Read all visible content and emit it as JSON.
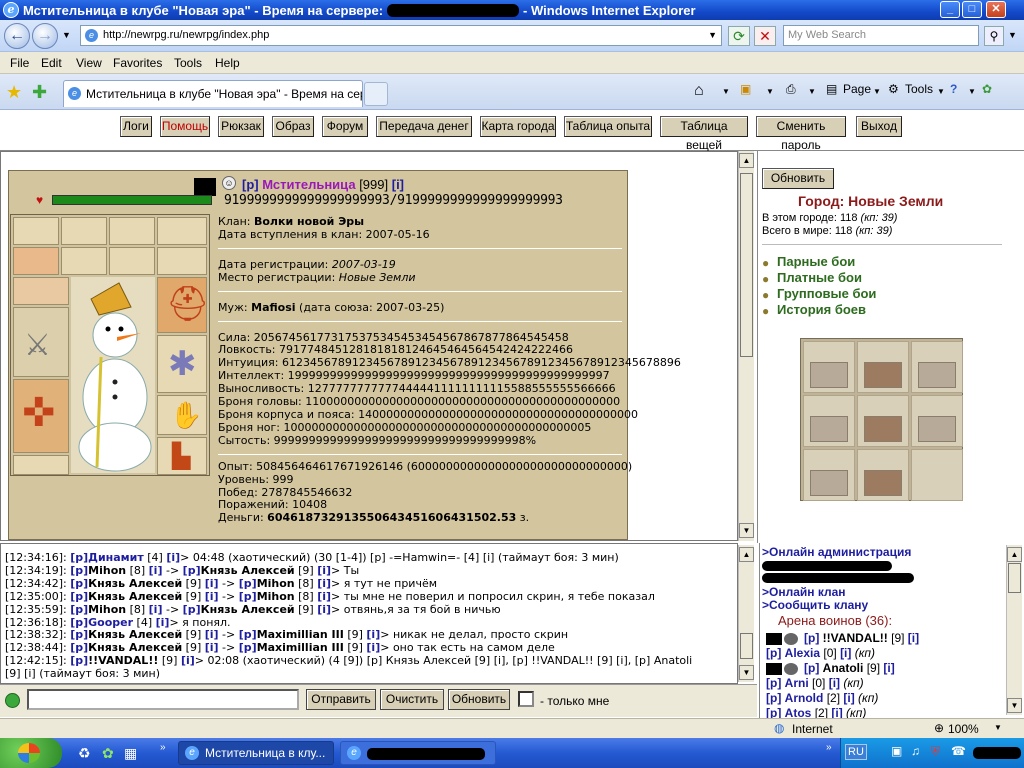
{
  "window": {
    "title_prefix": "Мстительница в клубе \"Новая эра\" - Время на сервере:",
    "title_suffix": "- Windows Internet Explorer",
    "minimize": "_",
    "maximize": "□",
    "close": "✕"
  },
  "address": {
    "url": "http://newrpg.ru/newrpg/index.php",
    "search_placeholder": "My Web Search"
  },
  "menu": [
    "File",
    "Edit",
    "View",
    "Favorites",
    "Tools",
    "Help"
  ],
  "tab": {
    "label": "Мстительница в клубе \"Новая эра\" - Время на сервер..."
  },
  "commandbar": {
    "page": "Page",
    "tools": "Tools"
  },
  "game_buttons": [
    "Логи",
    "Помощь",
    "Рюкзак",
    "Образ",
    "Форум",
    "Передача денег",
    "Карта города",
    "Таблица опыта",
    "Таблица вещей",
    "Сменить пароль",
    "Выход"
  ],
  "character": {
    "tag": "[p]",
    "name": "Мстительница",
    "level": "[999]",
    "info": "[i]",
    "hp": "9199999999999999999993/9199999999999999999993"
  },
  "profile": {
    "clan_label": "Клан:",
    "clan": "Волки новой Эры",
    "clan_join": "Дата вступления в клан: 2007-05-16",
    "reg_date_label": "Дата регистрации:",
    "reg_date": "2007-03-19",
    "reg_place_label": "Место регистрации:",
    "reg_place": "Новые Земли",
    "husband_label": "Муж:",
    "husband": "Mafiosi",
    "union": "(дата союза: 2007-03-25)",
    "stats": [
      "Сила: 205674561773175375345453454567867877864545458",
      "Ловкость: 791774845128181818124645464564542424222466",
      "Интуиция: 612345678912345678912345678912345678912345678912345678896",
      "Интеллект: 1999999999999999999999999999999999999999999997",
      "Выносливость: 12777777777774444411111111115588555555566666",
      "Броня головы: 110000000000000000000000000000000000000000000",
      "Броня корпуса и пояса: 1400000000000000000000000000000000000000",
      "Броня ног: 10000000000000000000000000000000000000000005",
      "Сытость: 999999999999999999999999999999999998%"
    ],
    "exp": "Опыт: 508456464617671926146 (6000000000000000000000000000000)",
    "level": "Уровень: 999",
    "wins": "Побед: 2787845546632",
    "losses": "Поражений: 10408",
    "money_label": "Деньги:",
    "money": "604618732913550643451606431502.53",
    "money_unit": "з."
  },
  "city": {
    "refresh": "Обновить",
    "title": "Город: Новые Земли",
    "in_city": "В этом городе: 118",
    "in_city_kp": "(кп: 39)",
    "in_world": "Всего в мире: 118",
    "in_world_kp": "(кп: 39)",
    "links": [
      "Парные бои",
      "Платные бои",
      "Групповые бои",
      "История боев"
    ]
  },
  "chat": [
    {
      "t": "[12:34:16]:",
      "text": [
        [
          "b",
          "[p]"
        ],
        [
          "nb",
          "Динамит"
        ],
        [
          "x",
          " [4] "
        ],
        [
          "b",
          "[i]"
        ],
        [
          "x",
          "> 04:48 (хаотический) (30 [1-4]) [p] -=Hamwin=- [4] [i] (таймаут боя: 3 мин)"
        ]
      ]
    },
    {
      "t": "[12:34:19]:",
      "text": [
        [
          "b",
          "[p]"
        ],
        [
          "n",
          "Mihon"
        ],
        [
          "x",
          " [8] "
        ],
        [
          "b",
          "[i]"
        ],
        [
          "x",
          " -> "
        ],
        [
          "b",
          "[p]"
        ],
        [
          "n",
          "Князь Алексей"
        ],
        [
          "x",
          " [9] "
        ],
        [
          "b",
          "[i]"
        ],
        [
          "x",
          "> Ты"
        ]
      ]
    },
    {
      "t": "[12:34:42]:",
      "text": [
        [
          "b",
          "[p]"
        ],
        [
          "n",
          "Князь Алексей"
        ],
        [
          "x",
          " [9] "
        ],
        [
          "b",
          "[i]"
        ],
        [
          "x",
          " -> "
        ],
        [
          "b",
          "[p]"
        ],
        [
          "n",
          "Mihon"
        ],
        [
          "x",
          " [8] "
        ],
        [
          "b",
          "[i]"
        ],
        [
          "x",
          "> я тут не причём"
        ]
      ]
    },
    {
      "t": "[12:35:00]:",
      "text": [
        [
          "b",
          "[p]"
        ],
        [
          "n",
          "Князь Алексей"
        ],
        [
          "x",
          " [9] "
        ],
        [
          "b",
          "[i]"
        ],
        [
          "x",
          " -> "
        ],
        [
          "b",
          "[p]"
        ],
        [
          "n",
          "Mihon"
        ],
        [
          "x",
          " [8] "
        ],
        [
          "b",
          "[i]"
        ],
        [
          "x",
          "> ты мне не поверил и попросил скрин, я тебе показал"
        ]
      ]
    },
    {
      "t": "[12:35:59]:",
      "text": [
        [
          "b",
          "[p]"
        ],
        [
          "n",
          "Mihon"
        ],
        [
          "x",
          " [8] "
        ],
        [
          "b",
          "[i]"
        ],
        [
          "x",
          " -> "
        ],
        [
          "b",
          "[p]"
        ],
        [
          "n",
          "Князь Алексей"
        ],
        [
          "x",
          " [9] "
        ],
        [
          "b",
          "[i]"
        ],
        [
          "x",
          "> отвянь,я за тя бой в ничью"
        ]
      ]
    },
    {
      "t": "[12:36:18]:",
      "text": [
        [
          "b",
          "[p]"
        ],
        [
          "nb",
          "Gooper"
        ],
        [
          "x",
          " [4] "
        ],
        [
          "b",
          "[i]"
        ],
        [
          "x",
          "> я понял."
        ]
      ]
    },
    {
      "t": "[12:38:32]:",
      "text": [
        [
          "b",
          "[p]"
        ],
        [
          "n",
          "Князь Алексей"
        ],
        [
          "x",
          " [9] "
        ],
        [
          "b",
          "[i]"
        ],
        [
          "x",
          " -> "
        ],
        [
          "b",
          "[p]"
        ],
        [
          "n",
          "Maximillian III"
        ],
        [
          "x",
          " [9] "
        ],
        [
          "b",
          "[i]"
        ],
        [
          "x",
          "> никак не делал, просто скрин"
        ]
      ]
    },
    {
      "t": "[12:38:44]:",
      "text": [
        [
          "b",
          "[p]"
        ],
        [
          "n",
          "Князь Алексей"
        ],
        [
          "x",
          " [9] "
        ],
        [
          "b",
          "[i]"
        ],
        [
          "x",
          " -> "
        ],
        [
          "b",
          "[p]"
        ],
        [
          "n",
          "Maximillian III"
        ],
        [
          "x",
          " [9] "
        ],
        [
          "b",
          "[i]"
        ],
        [
          "x",
          "> оно так есть на самом деле"
        ]
      ]
    },
    {
      "t": "[12:42:15]:",
      "text": [
        [
          "b",
          "[p]"
        ],
        [
          "n",
          "!!VANDAL!!"
        ],
        [
          "x",
          " [9] "
        ],
        [
          "b",
          "[i]"
        ],
        [
          "x",
          "> 02:08 (хаотический) (4 [9]) [p] Князь Алексей [9] [i], [p] !!VANDAL!! [9] [i], [p] Anatoli"
        ]
      ]
    }
  ],
  "chat_wrap": "[9] [i] (таймаут боя: 3 мин)",
  "chat_controls": {
    "send": "Отправить",
    "clear": "Очистить",
    "refresh": "Обновить",
    "only_me": "- только мне"
  },
  "online": {
    "admin": ">Онлайн администрация",
    "clan": ">Онлайн клан",
    "report": ">Сообщить клану",
    "arena": "Арена воинов (36):",
    "players": [
      {
        "tag": "[p]",
        "name": "!!VANDAL!!",
        "lvl": "[9]",
        "info": "[i]",
        "kp": ""
      },
      {
        "tag": "[p]",
        "name": "Alexia",
        "lvl": "[0]",
        "info": "[i]",
        "kp": "(кп)"
      },
      {
        "tag": "[p]",
        "name": "Anatoli",
        "lvl": "[9]",
        "info": "[i]",
        "kp": ""
      },
      {
        "tag": "[p]",
        "name": "Arni",
        "lvl": "[0]",
        "info": "[i]",
        "kp": "(кп)"
      },
      {
        "tag": "[p]",
        "name": "Arnold",
        "lvl": "[2]",
        "info": "[i]",
        "kp": "(кп)"
      },
      {
        "tag": "[p]",
        "name": "Atos",
        "lvl": "[2]",
        "info": "[i]",
        "kp": "(кп)"
      }
    ]
  },
  "status": {
    "zone": "Internet",
    "zoom": "100%"
  },
  "taskbar": {
    "task1": "Мстительница в клу...",
    "lang": "RU"
  },
  "colors": {
    "accent_blue": "#1d1d9f",
    "char_name": "#9b18b8",
    "city_title": "#8b1a1a",
    "battle_link": "#2d6b1f",
    "panel_beige": "#d3c69f"
  }
}
